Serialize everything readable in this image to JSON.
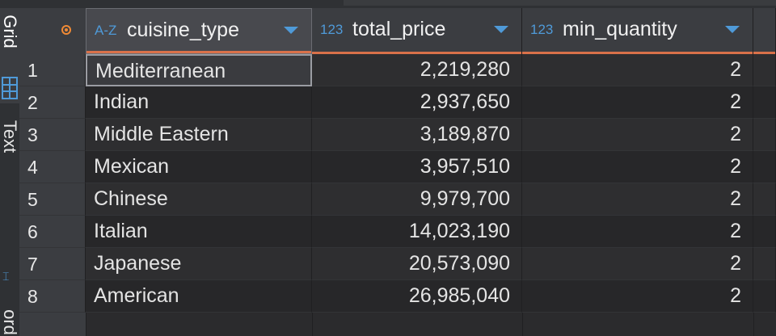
{
  "side_tabs": {
    "grid_label": "Grid",
    "text_label": "Text",
    "record_label": "ord"
  },
  "columns": [
    {
      "type_icon": "A-Z",
      "name": "cuisine_type"
    },
    {
      "type_icon": "123",
      "name": "total_price"
    },
    {
      "type_icon": "123",
      "name": "min_quantity"
    }
  ],
  "rows": [
    {
      "num": "1",
      "cuisine_type": "Mediterranean",
      "total_price": "2,219,280",
      "min_quantity": "2"
    },
    {
      "num": "2",
      "cuisine_type": "Indian",
      "total_price": "2,937,650",
      "min_quantity": "2"
    },
    {
      "num": "3",
      "cuisine_type": "Middle Eastern",
      "total_price": "3,189,870",
      "min_quantity": "2"
    },
    {
      "num": "4",
      "cuisine_type": "Mexican",
      "total_price": "3,957,510",
      "min_quantity": "2"
    },
    {
      "num": "5",
      "cuisine_type": "Chinese",
      "total_price": "9,979,700",
      "min_quantity": "2"
    },
    {
      "num": "6",
      "cuisine_type": "Italian",
      "total_price": "14,023,190",
      "min_quantity": "2"
    },
    {
      "num": "7",
      "cuisine_type": "Japanese",
      "total_price": "20,573,090",
      "min_quantity": "2"
    },
    {
      "num": "8",
      "cuisine_type": "American",
      "total_price": "26,985,040",
      "min_quantity": "2"
    }
  ],
  "colors": {
    "accent_blue": "#4f9ad8",
    "header_underline": "#d9714a",
    "corner_dot": "#f08a35"
  }
}
